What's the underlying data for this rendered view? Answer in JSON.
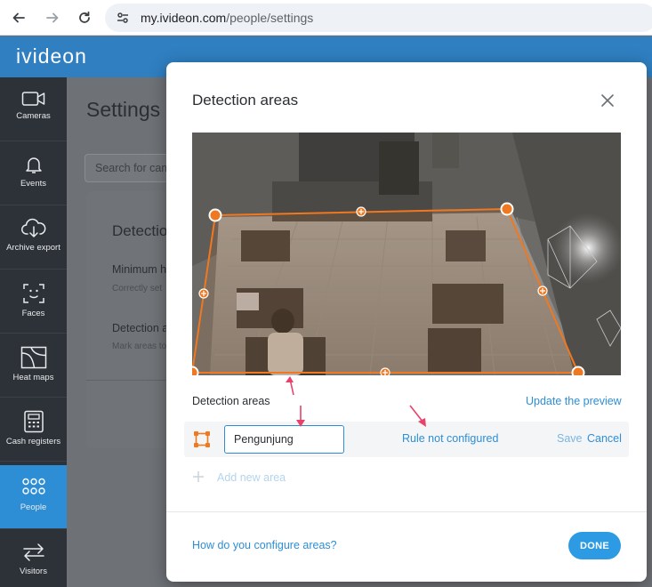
{
  "browser": {
    "url_host": "my.ivideon.com",
    "url_path": "/people/settings"
  },
  "app": {
    "logo": "ivideon"
  },
  "sidebar": {
    "items": [
      {
        "label": "Cameras",
        "icon": "camera-icon"
      },
      {
        "label": "Events",
        "icon": "bell-icon"
      },
      {
        "label": "Archive export",
        "icon": "cloud-download-icon"
      },
      {
        "label": "Faces",
        "icon": "face-scan-icon"
      },
      {
        "label": "Heat maps",
        "icon": "heat-map-icon"
      },
      {
        "label": "Cash registers",
        "icon": "cash-register-icon"
      },
      {
        "label": "People",
        "icon": "people-icon",
        "active": true
      },
      {
        "label": "Visitors",
        "icon": "arrows-exchange-icon"
      }
    ]
  },
  "settings": {
    "title": "Settings",
    "search_placeholder": "Search for cam",
    "card": {
      "heading": "Detectio",
      "min_title": "Minimum h",
      "min_sub": "Correctly set",
      "area_title": "Detection a",
      "area_sub": "Mark areas to"
    }
  },
  "modal": {
    "title": "Detection areas",
    "section_label": "Detection areas",
    "update_preview": "Update the preview",
    "area": {
      "name_value": "Pengunjung",
      "rule_status": "Rule not configured",
      "save_label": "Save",
      "cancel_label": "Cancel"
    },
    "add_area_label": "Add new area",
    "help_link": "How do you configure areas?",
    "done_label": "DONE"
  },
  "colors": {
    "accent": "#2d8ed6",
    "header": "#2f7fc1",
    "polygon": "#f07820",
    "annotation_arrow": "#e8426a"
  }
}
